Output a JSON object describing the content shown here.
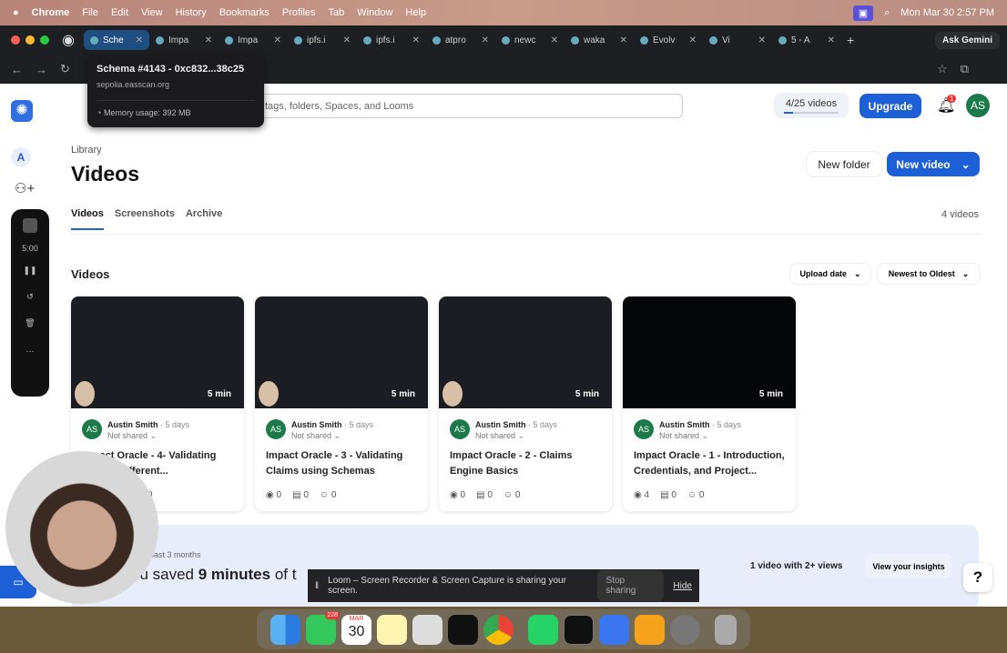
{
  "menubar": {
    "apple": "",
    "app": "Chrome",
    "items": [
      "File",
      "Edit",
      "View",
      "History",
      "Bookmarks",
      "Profiles",
      "Tab",
      "Window",
      "Help"
    ],
    "clock": "Mon Mar 30  2:57 PM"
  },
  "tabs": [
    {
      "label": "Sche",
      "active": true
    },
    {
      "label": "Impa"
    },
    {
      "label": "Impa"
    },
    {
      "label": "ipfs.i"
    },
    {
      "label": "ipfs.i"
    },
    {
      "label": "atpro"
    },
    {
      "label": "newc"
    },
    {
      "label": "waka"
    },
    {
      "label": "Evolv"
    },
    {
      "label": "Vi"
    },
    {
      "label": "5 - A"
    }
  ],
  "ask_gemini": "Ask Gemini",
  "tooltip": {
    "title": "Schema #4143 - 0xc832...38c25",
    "host": "sepolia.easscan.org",
    "memory": "Memory usage: 392 MB"
  },
  "header": {
    "search_placeholder": "tags, folders, Spaces, and Looms",
    "quota": "4/25 videos",
    "quota_fraction": 0.16,
    "upgrade": "Upgrade",
    "notif_count": "1",
    "avatar": "AS"
  },
  "sidebar": {
    "workspace": "A",
    "timer": "5:00"
  },
  "library": {
    "breadcrumb": "Library",
    "title": "Videos",
    "new_folder": "New folder",
    "new_video": "New video",
    "tabs": [
      "Videos",
      "Screenshots",
      "Archive"
    ],
    "count": "4 videos",
    "section": "Videos",
    "sort_field": "Upload date",
    "sort_order": "Newest to Oldest"
  },
  "videos": [
    {
      "author": "Austin Smith",
      "age": "· 5 days",
      "share": "Not shared",
      "title": "Impact Oracle - 4- Validating Across Different...",
      "duration": "5 min",
      "views": "0",
      "comments": "0",
      "reactions": "0"
    },
    {
      "author": "Austin Smith",
      "age": "· 5 days",
      "share": "Not shared",
      "title": "Impact Oracle - 3 - Validating Claims using Schemas",
      "duration": "5 min",
      "views": "0",
      "comments": "0",
      "reactions": "0"
    },
    {
      "author": "Austin Smith",
      "age": "· 5 days",
      "share": "Not shared",
      "title": "Impact Oracle - 2 - Claims Engine Basics",
      "duration": "5 min",
      "views": "0",
      "comments": "0",
      "reactions": "0"
    },
    {
      "author": "Austin Smith",
      "age": "· 5 days",
      "share": "Not shared",
      "title": "Impact Oracle - 1 - Introduction, Credentials, and Project...",
      "duration": "5 min",
      "views": "4",
      "comments": "0",
      "reactions": "0"
    }
  ],
  "insights": {
    "period": "past 3 months",
    "saved_prefix": "ou saved ",
    "saved_value": "9 minutes",
    "saved_suffix": " of t",
    "stat": "1 video with 2+ views",
    "link": "View your insights",
    "help": "?"
  },
  "sharebar": {
    "text": "Loom – Screen Recorder & Screen Capture is sharing your screen.",
    "stop": "Stop sharing",
    "hide": "Hide"
  },
  "dock": {
    "messages_badge": "228",
    "calendar_month": "MAR",
    "calendar_day": "30"
  }
}
